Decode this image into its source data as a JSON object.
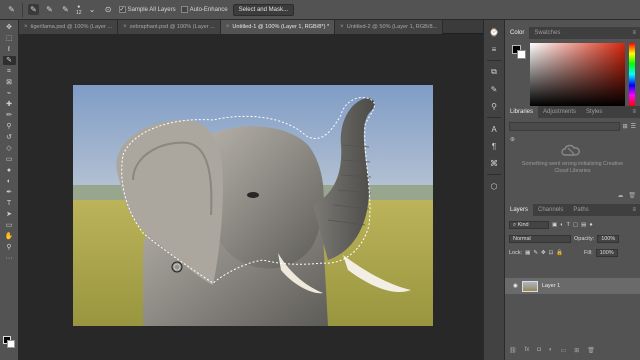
{
  "options_bar": {
    "brush_size": "12",
    "sample_all_layers_label": "Sample All Layers",
    "auto_enhance_label": "Auto-Enhance",
    "select_mask_label": "Select and Mask..."
  },
  "tabs": [
    {
      "label": "tigerllama.psd @ 100% (Layer ...",
      "active": false
    },
    {
      "label": "zebraphant.psd @ 100% (Layer ...",
      "active": false
    },
    {
      "label": "Untitled-1 @ 100% (Layer 1, RGB/8*) *",
      "active": true
    },
    {
      "label": "Untitled-2 @ 50% (Layer 1, RGB/8...",
      "active": false
    }
  ],
  "panels": {
    "color": {
      "tabs": [
        "Color",
        "Swatches"
      ],
      "accent_hue": "#d7260d"
    },
    "libraries": {
      "tabs": [
        "Libraries",
        "Adjustments",
        "Styles"
      ],
      "message": "Something went wrong initializing Creative Cloud Libraries"
    },
    "layers": {
      "tabs": [
        "Layers",
        "Channels",
        "Paths"
      ],
      "kind_label": "Kind",
      "blend_mode": "Normal",
      "opacity_label": "Opacity:",
      "opacity_value": "100%",
      "lock_label": "Lock:",
      "fill_label": "Fill:",
      "fill_value": "100%",
      "layer_name": "Layer 1"
    }
  },
  "icons": {
    "toolbar": [
      "move-icon",
      "marquee-icon",
      "lasso-icon",
      "quick-select-icon",
      "crop-icon",
      "eyedropper-icon",
      "healing-icon",
      "brush-icon",
      "clone-stamp-icon",
      "history-brush-icon",
      "eraser-icon",
      "gradient-icon",
      "blur-icon",
      "dodge-icon",
      "pen-icon",
      "type-icon",
      "path-select-icon",
      "shape-icon",
      "hand-icon",
      "zoom-icon"
    ]
  }
}
